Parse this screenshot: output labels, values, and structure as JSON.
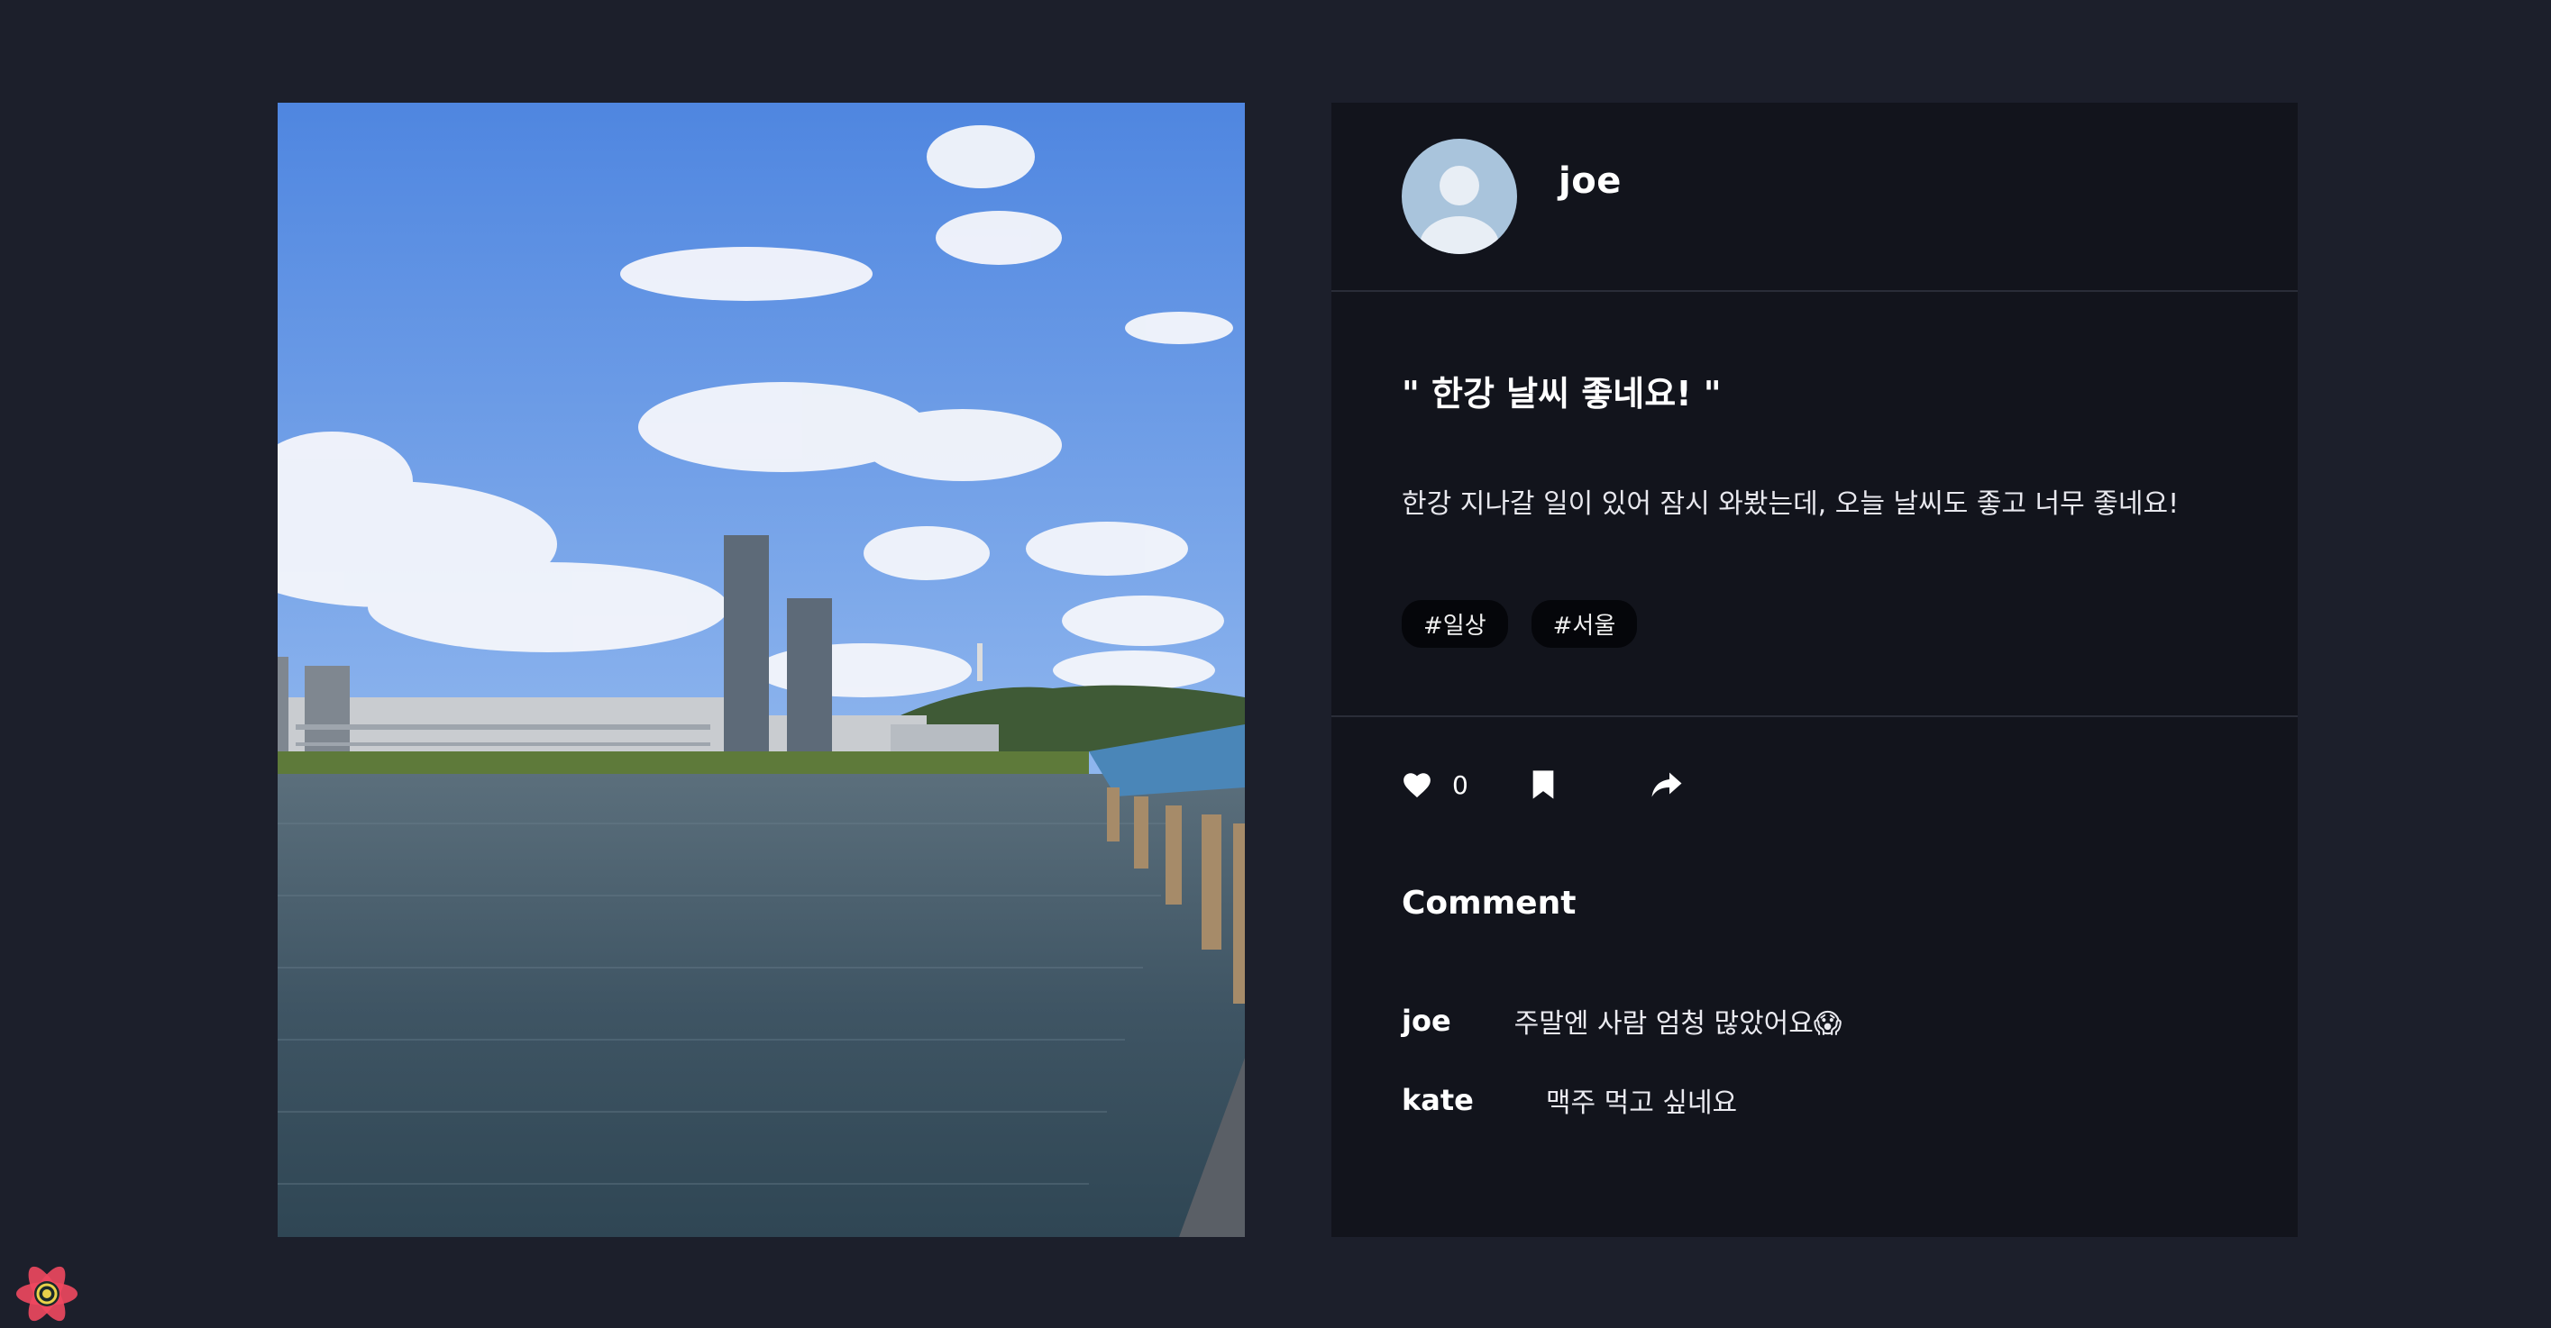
{
  "post": {
    "author": "joe",
    "title": "\" 한강 날씨 좋네요! \"",
    "body": "한강 지나갈 일이 있어 잠시 와봤는데, 오늘 날씨도 좋고 너무 좋네요!",
    "tags": [
      "#일상",
      "#서울"
    ],
    "likes": "0"
  },
  "comments_section": {
    "title": "Comment",
    "items": [
      {
        "user": "joe",
        "text": "주말엔 사람 엄청 많았어요😱"
      },
      {
        "user": "kate",
        "text": "맥주 먹고 싶네요"
      }
    ]
  },
  "icons": {
    "like": "heart-icon",
    "bookmark": "bookmark-icon",
    "share": "share-icon",
    "devtools": "react-devtools-icon"
  },
  "colors": {
    "page_bg": "#1c1f2b",
    "panel_bg": "#12141c",
    "tag_bg": "#05060a",
    "avatar_bg": "#a9c4dc"
  }
}
